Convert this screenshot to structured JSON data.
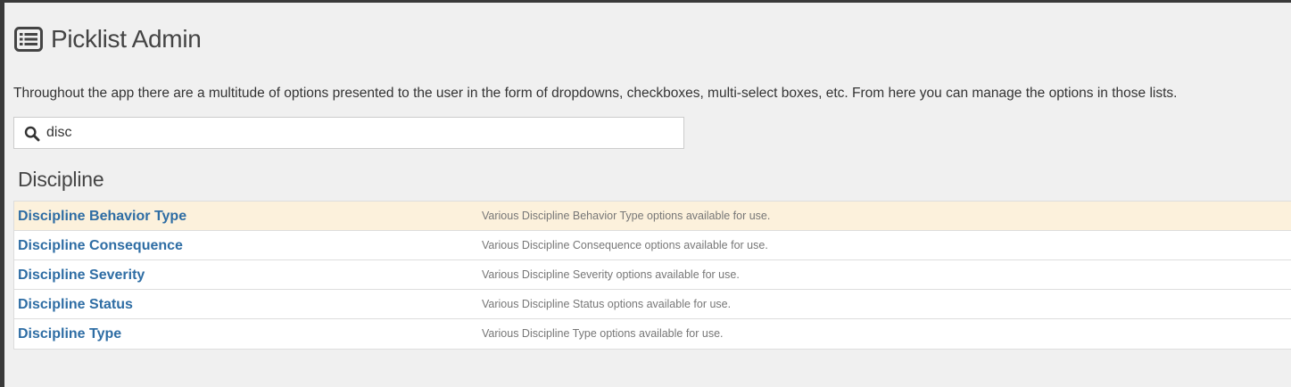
{
  "header": {
    "title": "Picklist Admin",
    "icon": "list-alt-icon"
  },
  "intro": "Throughout the app there are a multitude of options presented to the user in the form of dropdowns, checkboxes, multi-select boxes, etc. From here you can manage the options in those lists.",
  "search": {
    "value": "disc",
    "icon": "search-icon"
  },
  "section": {
    "title": "Discipline",
    "rows": [
      {
        "name": "Discipline Behavior Type",
        "description": "Various Discipline Behavior Type options available for use.",
        "highlighted": true
      },
      {
        "name": "Discipline Consequence",
        "description": "Various Discipline Consequence options available for use.",
        "highlighted": false
      },
      {
        "name": "Discipline Severity",
        "description": "Various Discipline Severity options available for use.",
        "highlighted": false
      },
      {
        "name": "Discipline Status",
        "description": "Various Discipline Status options available for use.",
        "highlighted": false
      },
      {
        "name": "Discipline Type",
        "description": "Various Discipline Type options available for use.",
        "highlighted": false
      }
    ]
  },
  "colors": {
    "link": "#2e6da4",
    "highlight_row": "#fcf1dc",
    "page_bg": "#f0f0f0"
  }
}
